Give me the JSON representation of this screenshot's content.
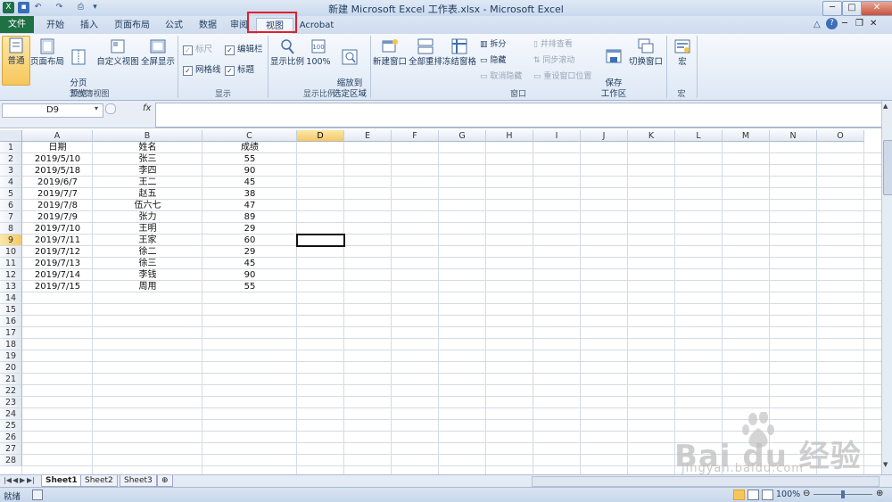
{
  "window": {
    "title": "新建 Microsoft Excel 工作表.xlsx - Microsoft Excel",
    "minimize": "─",
    "maximize": "□",
    "close": "✕"
  },
  "quick_access": [
    "excel-logo-icon",
    "save-icon",
    "undo-icon",
    "redo-icon",
    "print-preview-icon",
    "customize-icon"
  ],
  "tabs": [
    {
      "label": "文件"
    },
    {
      "label": "开始"
    },
    {
      "label": "插入"
    },
    {
      "label": "页面布局"
    },
    {
      "label": "公式"
    },
    {
      "label": "数据"
    },
    {
      "label": "审阅"
    },
    {
      "label": "视图"
    },
    {
      "label": "Acrobat"
    }
  ],
  "ribbon": {
    "workbook_views": {
      "group": "工作簿视图",
      "normal": "普通",
      "page_layout": "页面布局",
      "page_break": "分页\n预览",
      "custom_views": "自定义视图",
      "full_screen": "全屏显示"
    },
    "show": {
      "group": "显示",
      "ruler": "标尺",
      "formula_bar": "编辑栏",
      "gridlines": "网格线",
      "headings": "标题"
    },
    "zoom": {
      "group": "显示比例",
      "zoom": "显示比例",
      "hundred": "100%",
      "zoom_selection": "缩放到\n选定区域"
    },
    "window": {
      "group": "窗口",
      "new_window": "新建窗口",
      "arrange_all": "全部重排",
      "freeze_panes": "冻结窗格",
      "split": "拆分",
      "hide": "隐藏",
      "unhide": "取消隐藏",
      "side_by_side": "并排查看",
      "sync_scroll": "同步滚动",
      "reset_position": "重设窗口位置",
      "save_workspace": "保存\n工作区",
      "switch_windows": "切换窗口"
    },
    "macros": {
      "group": "宏",
      "macros": "宏"
    }
  },
  "formula_bar": {
    "name_box": "D9",
    "fx": "fx",
    "value": ""
  },
  "columns": [
    "A",
    "B",
    "C",
    "D",
    "E",
    "F",
    "G",
    "H",
    "I",
    "J",
    "K",
    "L",
    "M",
    "N",
    "O"
  ],
  "selected_column": "D",
  "selected_row": 9,
  "rows": [
    "1",
    "2",
    "3",
    "4",
    "5",
    "6",
    "7",
    "8",
    "9",
    "10",
    "11",
    "12",
    "13",
    "14",
    "15",
    "16",
    "17",
    "18",
    "19",
    "20",
    "21",
    "22",
    "23",
    "24",
    "25",
    "26",
    "27",
    "28"
  ],
  "table": {
    "headers": [
      "日期",
      "姓名",
      "成绩"
    ],
    "data": [
      [
        "2019/5/10",
        "张三",
        "55"
      ],
      [
        "2019/5/18",
        "李四",
        "90"
      ],
      [
        "2019/6/7",
        "王二",
        "45"
      ],
      [
        "2019/7/7",
        "赵五",
        "38"
      ],
      [
        "2019/7/8",
        "伍六七",
        "47"
      ],
      [
        "2019/7/9",
        "张力",
        "89"
      ],
      [
        "2019/7/10",
        "王明",
        "29"
      ],
      [
        "2019/7/11",
        "王家",
        "60"
      ],
      [
        "2019/7/12",
        "徐二",
        "29"
      ],
      [
        "2019/7/13",
        "徐三",
        "45"
      ],
      [
        "2019/7/14",
        "李钱",
        "90"
      ],
      [
        "2019/7/15",
        "周用",
        "55"
      ]
    ]
  },
  "sheets": [
    {
      "label": "Sheet1",
      "active": true
    },
    {
      "label": "Sheet2",
      "active": false
    },
    {
      "label": "Sheet3",
      "active": false
    }
  ],
  "status": {
    "ready": "就绪",
    "zoom": "100%"
  },
  "watermark": {
    "brand": "Bai du 经验",
    "url": "jingyan.baidu.com"
  },
  "colors": {
    "file_tab": "#1e7145",
    "highlight_box": "#e0202a",
    "selected_header": "#f5c964"
  }
}
